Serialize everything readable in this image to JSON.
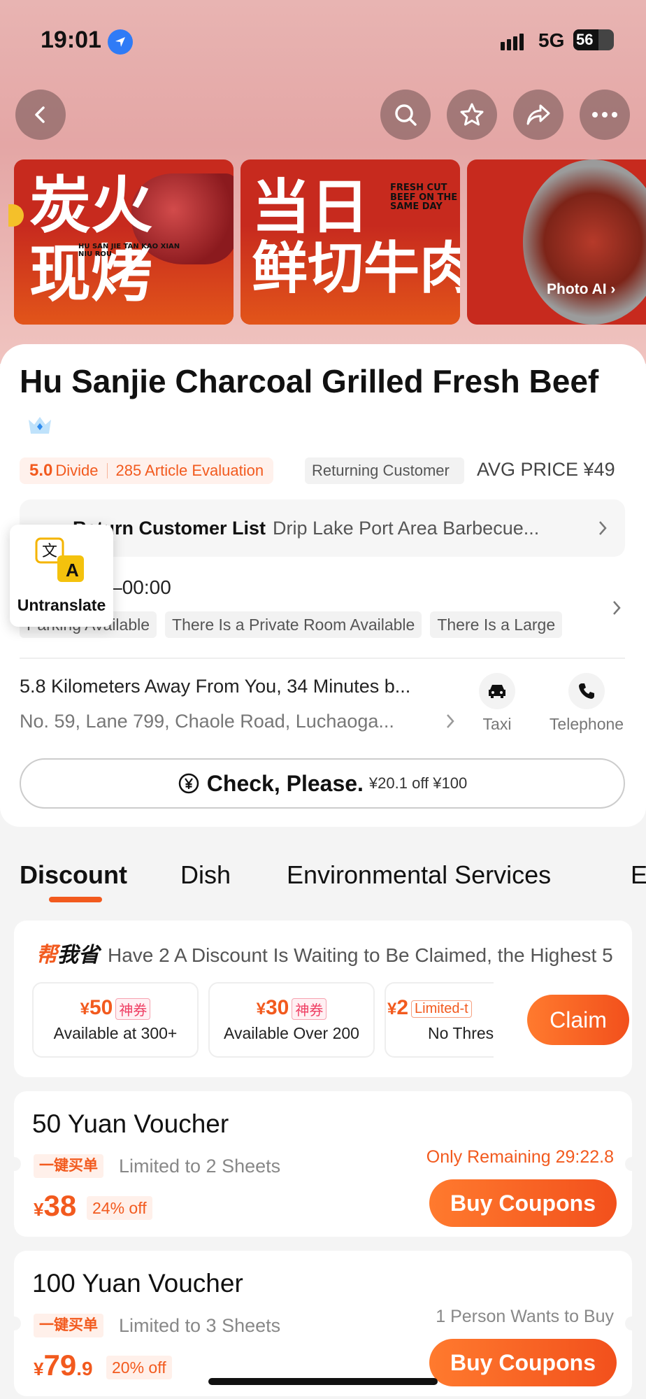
{
  "status": {
    "time": "19:01",
    "network": "5G",
    "battery": "56"
  },
  "banner": {
    "b1_line1": "炭火",
    "b1_line2": "现烤",
    "b1_small": "HU SAN JIE TAN KAO XIAN NIU ROU",
    "b2_line1": "当日",
    "b2_line2": "鲜切牛肉",
    "b2_small": "FRESH CUT BEEF ON THE SAME DAY",
    "photo_ai": "Photo AI"
  },
  "shop": {
    "title": "Hu Sanjie Charcoal Grilled Fresh Beef",
    "score": "5.0",
    "score_label": "Divide",
    "evaluations": "285 Article Evaluation",
    "returning_tag": "Returning Customer",
    "avg_price": "AVG PRICE ¥49",
    "return_list_key": "Return Customer List",
    "return_list_val": "Drip Lake Port Area Barbecue...",
    "hours": "00–00:00",
    "amenities": [
      "Parking Available",
      "There Is a Private Room Available",
      "There Is a Large"
    ],
    "distance": "5.8 Kilometers Away From You, 34 Minutes b...",
    "address": "No. 59, Lane 799, Chaole Road, Luchaoga...",
    "taxi_label": "Taxi",
    "telephone_label": "Telephone",
    "check_label": "Check, Please.",
    "check_offer": "¥20.1 off ¥100"
  },
  "translate": {
    "label": "Untranslate",
    "glyph_a": "文",
    "glyph_b": "A"
  },
  "tabs": [
    "Discount",
    "Dish",
    "Environmental Services",
    "E"
  ],
  "discount": {
    "logo_a": "帮",
    "logo_b": "我省",
    "headline": "Have 2 A Discount Is Waiting to Be Claimed, the Highest 5",
    "coupons": [
      {
        "currency": "¥",
        "amount": "50",
        "badge": "神券",
        "cond": "Available at 300+"
      },
      {
        "currency": "¥",
        "amount": "30",
        "badge": "神券",
        "cond": "Available Over 200"
      },
      {
        "currency": "¥",
        "amount": "2",
        "badge": "Limited-t",
        "cond": "No Thres"
      }
    ],
    "claim": "Claim"
  },
  "vouchers": [
    {
      "title": "50 Yuan Voucher",
      "tag": "一键买单",
      "limit": "Limited to 2 Sheets",
      "currency": "¥",
      "price": "38",
      "price_dec": "",
      "off": "24% off",
      "note": "Only Remaining 29:22.8",
      "note_color": "#f25a1e",
      "buy": "Buy Coupons"
    },
    {
      "title": "100 Yuan Voucher",
      "tag": "一键买单",
      "limit": "Limited to 3 Sheets",
      "currency": "¥",
      "price": "79",
      "price_dec": ".9",
      "off": "20% off",
      "note": "1 Person Wants to Buy",
      "note_color": "#888888",
      "buy": "Buy Coupons"
    }
  ]
}
